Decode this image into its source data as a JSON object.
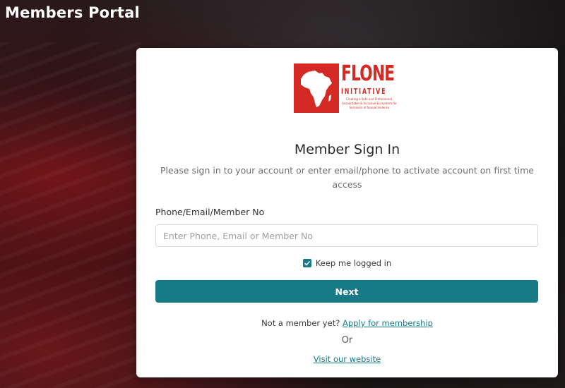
{
  "header": {
    "title": "Members Portal"
  },
  "logo": {
    "name": "FLONE",
    "subtitle": "INITIATIVE",
    "tagline": "Creating a Safe and Professional, Accountable & Inclusive Ecosystem for Survivors of Sexual Violence",
    "brand_color": "#d42a23"
  },
  "signin": {
    "heading": "Member Sign In",
    "description": "Please sign in to your account or enter email/phone to activate account on first time access",
    "field_label": "Phone/Email/Member No",
    "field_value": "",
    "field_placeholder": "Enter Phone, Email or Member No",
    "keep_logged_in_label": "Keep me logged in",
    "keep_logged_in_checked": true,
    "next_label": "Next",
    "not_member_text": "Not a member yet?",
    "apply_link": "Apply for membership",
    "or_text": "Or",
    "website_link": "Visit our website"
  },
  "colors": {
    "accent": "#177a86",
    "card_background": "#ffffff"
  }
}
